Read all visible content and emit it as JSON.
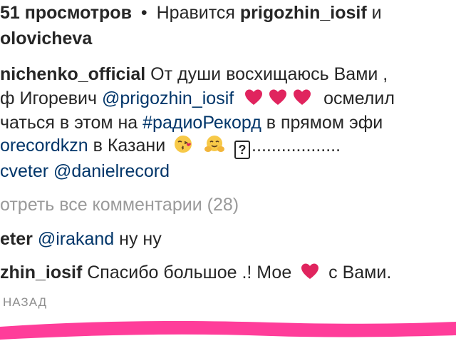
{
  "stats": {
    "views": "51 просмотров",
    "dot": "•",
    "likes_prefix": "Нравится",
    "liker": "prigozhin_iosif",
    "and": "и",
    "liker2": "olovicheva"
  },
  "caption": {
    "username": "nichenko_official",
    "text1": "От души восхищаюсь Вами ,",
    "line2_prefix": "ф Игоревич",
    "mention1": "@prigozhin_iosif",
    "line2_suffix": "осмелил",
    "line3_prefix": "чаться в этом на",
    "hashtag": "#радиоРекорд",
    "line3_suffix": "в прямом эфи",
    "mention2": "orecordkzn",
    "line4_text": "в Казани",
    "line4_dots": "..................",
    "mention3": "cveter",
    "mention4": "@danielrecord"
  },
  "view_all": "отреть все комментарии (28)",
  "comments": [
    {
      "username": "eter",
      "mention": "@irakand",
      "text": "ну ну"
    },
    {
      "username": "zhin_iosif",
      "text1": "Спасибо большое .! Мое",
      "text2": "с Вами."
    }
  ],
  "back_label": "НАЗАД",
  "colors": {
    "heart": "#e0245e",
    "link": "#003569",
    "pink": "#ff3d9a"
  },
  "icons": [
    "heart-emoji",
    "kiss-emoji",
    "hug-emoji",
    "unknown-glyph"
  ]
}
